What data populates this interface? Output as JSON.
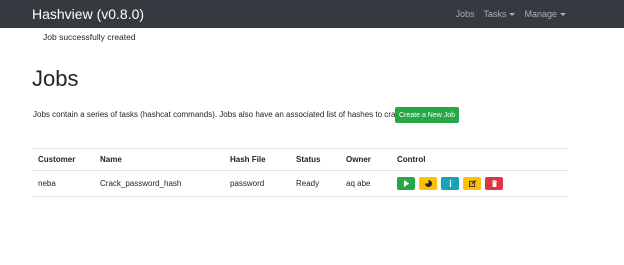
{
  "navbar": {
    "brand": "Hashview (v0.8.0)",
    "items": [
      "Jobs",
      "Tasks",
      "Manage"
    ]
  },
  "flash": "Job successfully created",
  "page": {
    "title": "Jobs",
    "description": "Jobs contain a series of tasks (hashcat commands). Jobs also have an associated list of hashes to crack.",
    "create_button": "Create a New Job"
  },
  "table": {
    "headers": [
      "Customer",
      "Name",
      "Hash File",
      "Status",
      "Owner",
      "Control"
    ],
    "rows": [
      [
        "neba",
        "Crack_password_hash",
        "password",
        "Ready",
        "aq abe"
      ]
    ]
  },
  "controls": [
    {
      "icon": "play-icon",
      "color": "#28a745"
    },
    {
      "icon": "chart-pie-icon",
      "color": "#ffc107"
    },
    {
      "icon": "info-icon",
      "color": "#17a2b8"
    },
    {
      "icon": "edit-icon",
      "color": "#ffc107"
    },
    {
      "icon": "trash-icon",
      "color": "#dc3545"
    }
  ]
}
